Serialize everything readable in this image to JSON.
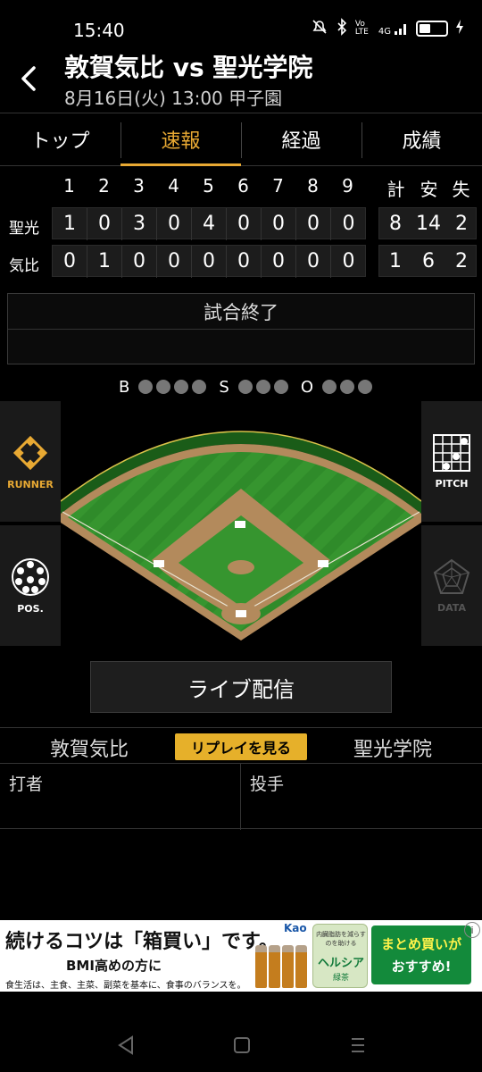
{
  "status_bar": {
    "time": "15:40",
    "icons": [
      "mute-icon",
      "bluetooth-icon",
      "volte-icon",
      "4g-signal-icon",
      "battery-icon",
      "charging-icon"
    ],
    "volte_text": "Vo LTE",
    "network_text": "4G"
  },
  "header": {
    "title": "敦賀気比 vs 聖光学院",
    "subtitle": "8月16日(火) 13:00 甲子園"
  },
  "tabs": [
    {
      "label": "トップ",
      "active": false
    },
    {
      "label": "速報",
      "active": true
    },
    {
      "label": "経過",
      "active": false
    },
    {
      "label": "成績",
      "active": false
    }
  ],
  "scoreboard": {
    "innings": [
      "1",
      "2",
      "3",
      "4",
      "5",
      "6",
      "7",
      "8",
      "9"
    ],
    "stat_headers": [
      "計",
      "安",
      "失"
    ],
    "teams": [
      {
        "short": "聖光",
        "scores": [
          "1",
          "0",
          "3",
          "0",
          "4",
          "0",
          "0",
          "0",
          "0"
        ],
        "stats": [
          "8",
          "14",
          "2"
        ]
      },
      {
        "short": "気比",
        "scores": [
          "0",
          "1",
          "0",
          "0",
          "0",
          "0",
          "0",
          "0",
          "0"
        ],
        "stats": [
          "1",
          "6",
          "2"
        ]
      }
    ]
  },
  "game_status": {
    "line1": "試合終了",
    "line2": ""
  },
  "count": {
    "balls_label": "B",
    "strikes_label": "S",
    "outs_label": "O",
    "balls": 0,
    "strikes": 0,
    "outs": 0
  },
  "side_buttons": {
    "runner": "RUNNER",
    "pitch": "PITCH",
    "pos": "POS.",
    "data": "DATA"
  },
  "live_button": "ライブ配信",
  "team_row": {
    "away": "敦賀気比",
    "replay": "リプレイを見る",
    "home": "聖光学院"
  },
  "player_boxes": {
    "batter_label": "打者",
    "pitcher_label": "投手"
  },
  "ad": {
    "headline": "続けるコツは「箱買い」です。",
    "sub": "BMI高めの方に",
    "small": "食生活は、主食、主菜、副菜を基本に、食事のバランスを。",
    "brand": "Kao",
    "product_tag": "内臓脂肪を減らすのを助ける",
    "product_name": "ヘルシア",
    "product_sub": "緑茶",
    "cta_line1": "まとめ買いが",
    "cta_line2": "おすすめ!",
    "info_label": "i"
  },
  "colors": {
    "accent": "#e8a933",
    "grass": "#2f8b2a",
    "dirt": "#b38a5c",
    "replay": "#e6b02a",
    "ad_green": "#138a3b"
  }
}
